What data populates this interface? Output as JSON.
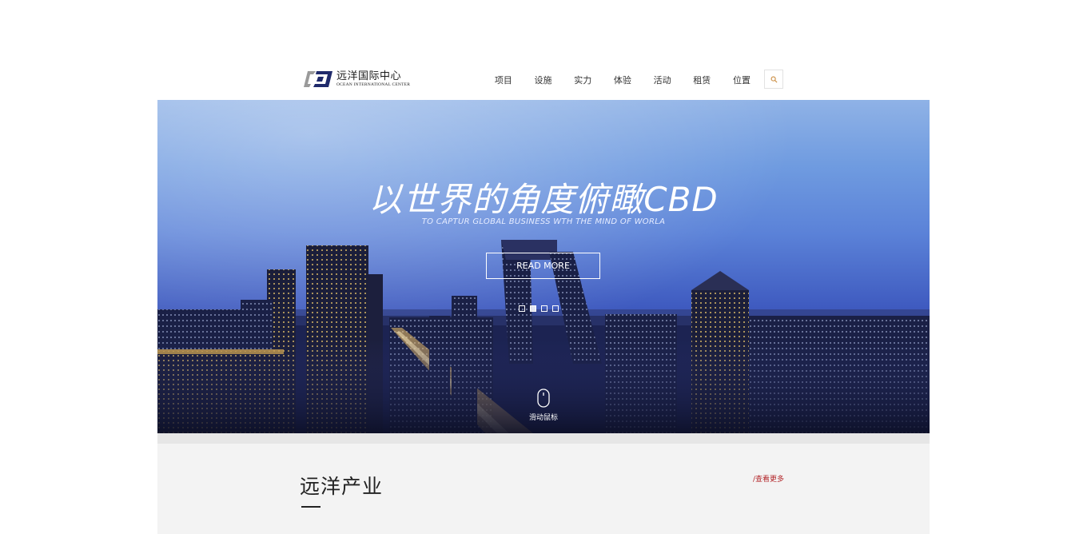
{
  "header": {
    "logo": {
      "name_cn": "远洋国际中心",
      "name_en": "OCEAN INTERNATIONAL CENTER"
    },
    "nav": [
      {
        "label": "项目"
      },
      {
        "label": "设施"
      },
      {
        "label": "实力"
      },
      {
        "label": "体验"
      },
      {
        "label": "活动"
      },
      {
        "label": "租赁"
      },
      {
        "label": "位置"
      }
    ],
    "search_icon": "search-icon"
  },
  "hero": {
    "title": "以世界的角度俯瞰CBD",
    "subtitle": "TO CAPTUR GLOBAL BUSINESS WTH THE MIND OF WORLA",
    "button_label": "READ MORE",
    "slides": {
      "count": 4,
      "active_index": 1
    },
    "scroll_hint": "滑动鼠标"
  },
  "section": {
    "title": "远洋产业",
    "more_link": "/查看更多"
  },
  "colors": {
    "accent": "#b3262a",
    "hero_sky_top": "#8fb2e6",
    "hero_sky_bottom": "#151c46"
  }
}
